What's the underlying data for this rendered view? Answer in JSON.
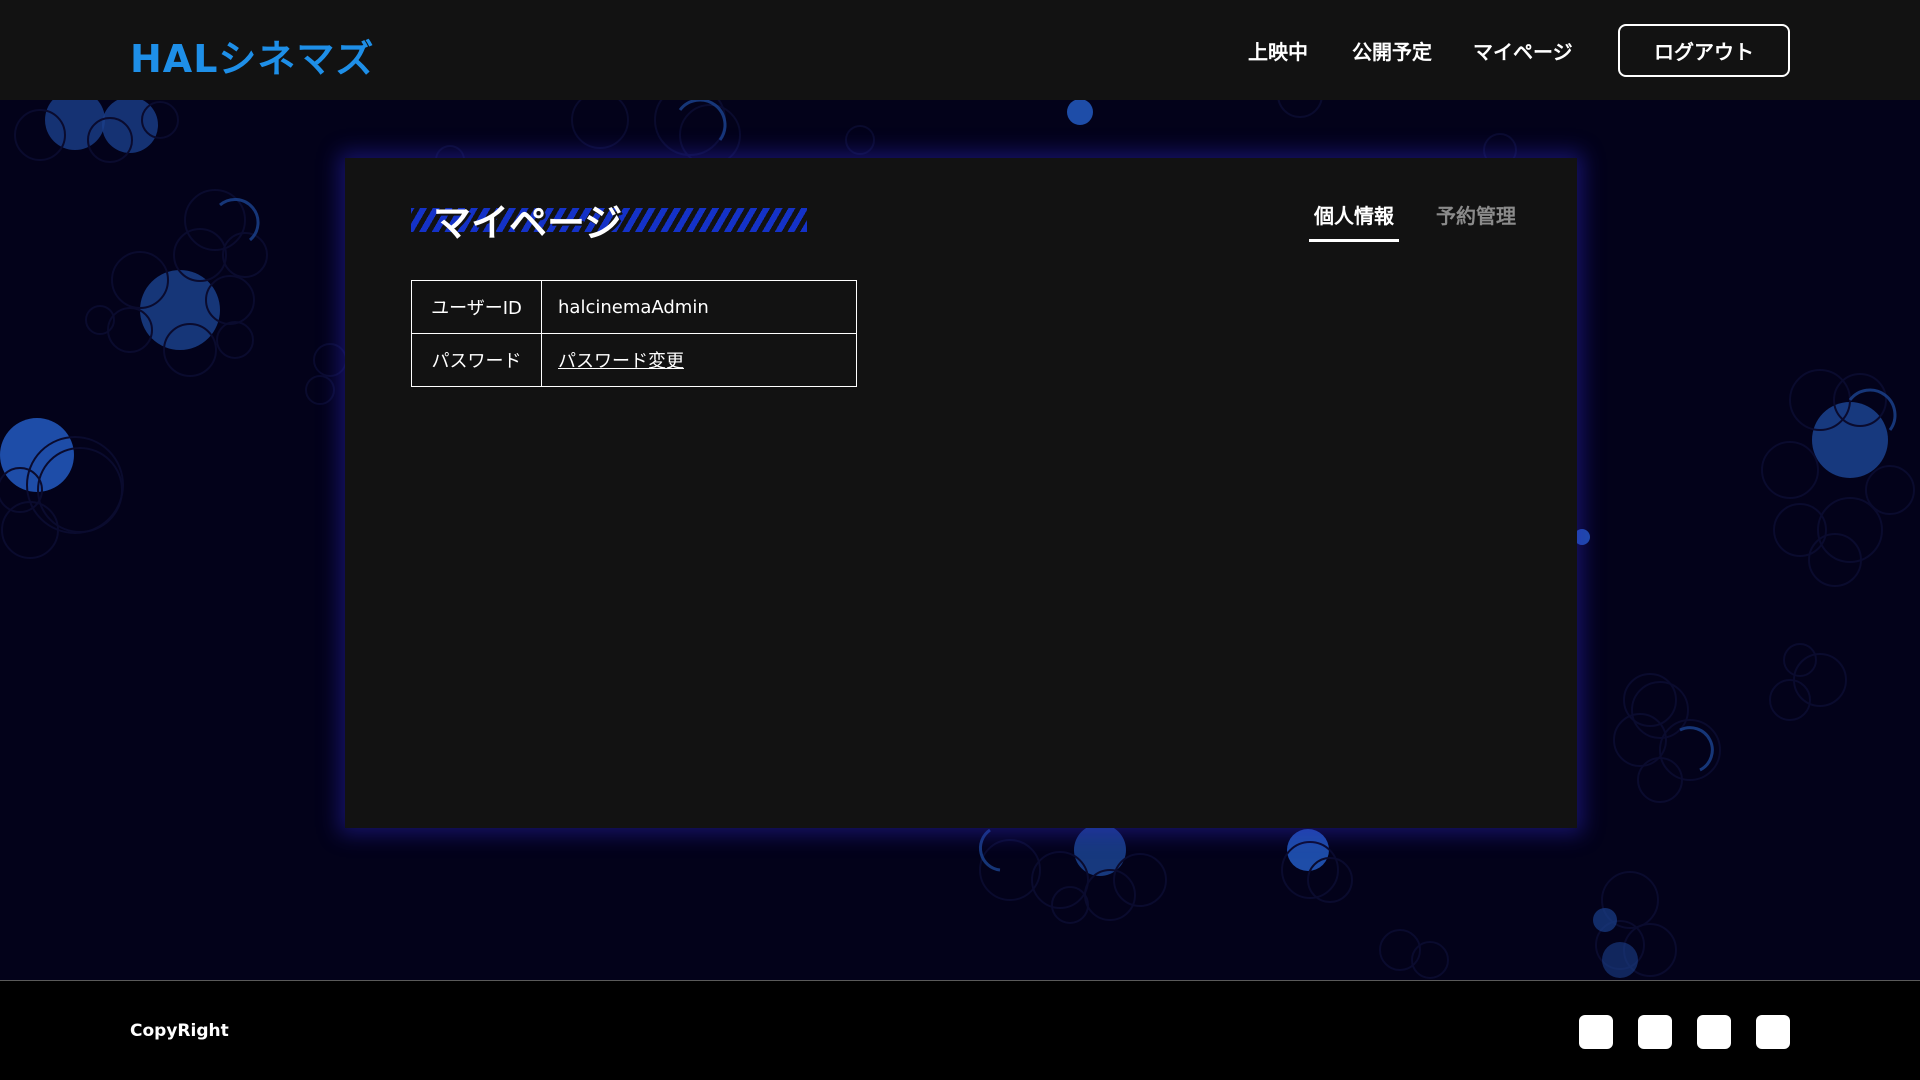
{
  "header": {
    "logo": "HALシネマズ",
    "nav": [
      "上映中",
      "公開予定",
      "マイページ"
    ],
    "logout_label": "ログアウト"
  },
  "main": {
    "title": "マイページ",
    "tabs": [
      {
        "label": "個人情報",
        "active": true
      },
      {
        "label": "予約管理",
        "active": false
      }
    ],
    "table": [
      {
        "label": "ユーザーID",
        "value": "halcinemaAdmin"
      },
      {
        "label": "パスワード",
        "value": "パスワード変更"
      }
    ]
  },
  "footer": {
    "copyright": "CopyRight",
    "social_icons": [
      "social-icon-1",
      "social-icon-2",
      "social-icon-3",
      "social-icon-4"
    ]
  },
  "colors": {
    "background": "#03021a",
    "header_bg": "#121212",
    "panel_bg": "#121212",
    "accent": "#1e8fe8",
    "title_stripe": "#1432c8",
    "bubble_fill": "#1a3f8a",
    "footer_bg": "#000000"
  }
}
